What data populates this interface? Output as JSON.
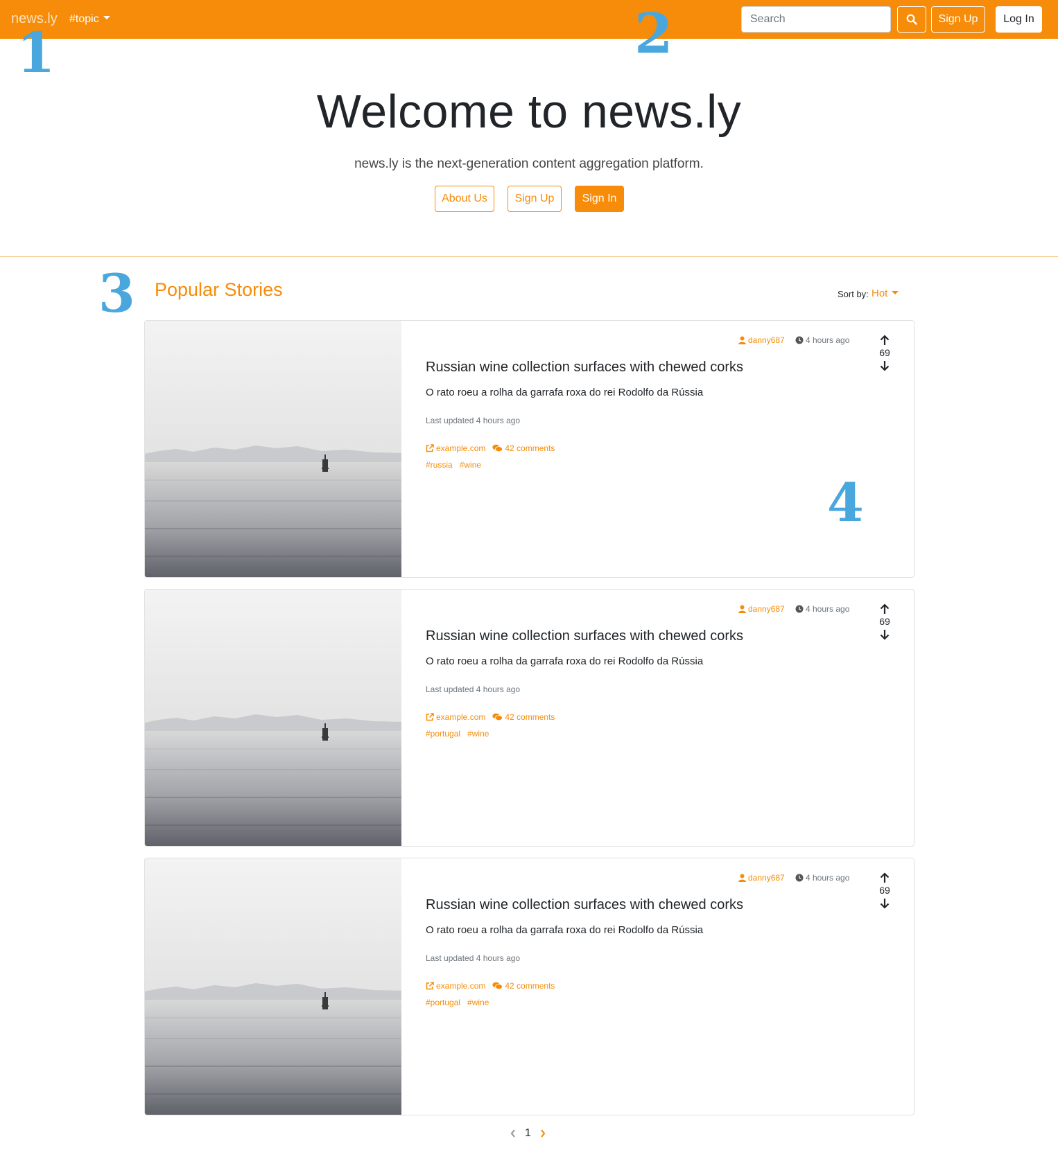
{
  "navbar": {
    "brand": "news.ly",
    "topic_dropdown": "#topic",
    "search_placeholder": "Search",
    "signup_label": "Sign Up",
    "login_label": "Log In",
    "accent_color": "#f68c09"
  },
  "annotations": [
    "1",
    "2",
    "3",
    "4"
  ],
  "hero": {
    "title": "Welcome to news.ly",
    "lead": "news.ly is the next-generation content aggregation platform.",
    "about_label": "About Us",
    "signup_label": "Sign Up",
    "signin_label": "Sign In"
  },
  "section": {
    "title": "Popular Stories",
    "sort_label": "Sort by:",
    "sort_value": "Hot"
  },
  "stories": [
    {
      "author": "danny687",
      "time": "4 hours ago",
      "votes": "69",
      "title": "Russian wine collection surfaces with chewed corks",
      "description": "O rato roeu a rolha da garrafa roxa do rei Rodolfo da Rússia",
      "updated": "Last updated 4 hours ago",
      "source": "example.com",
      "comments": "42 comments",
      "tags": [
        "#russia",
        "#wine"
      ]
    },
    {
      "author": "danny687",
      "time": "4 hours ago",
      "votes": "69",
      "title": "Russian wine collection surfaces with chewed corks",
      "description": "O rato roeu a rolha da garrafa roxa do rei Rodolfo da Rússia",
      "updated": "Last updated 4 hours ago",
      "source": "example.com",
      "comments": "42 comments",
      "tags": [
        "#portugal",
        "#wine"
      ]
    },
    {
      "author": "danny687",
      "time": "4 hours ago",
      "votes": "69",
      "title": "Russian wine collection surfaces with chewed corks",
      "description": "O rato roeu a rolha da garrafa roxa do rei Rodolfo da Rússia",
      "updated": "Last updated 4 hours ago",
      "source": "example.com",
      "comments": "42 comments",
      "tags": [
        "#portugal",
        "#wine"
      ]
    }
  ],
  "pagination": {
    "current_page": "1"
  },
  "icons": {
    "search": "search-icon",
    "user": "user-icon",
    "clock": "clock-icon",
    "upvote": "arrow-up-icon",
    "downvote": "arrow-down-icon",
    "external_link": "external-link-icon",
    "comments": "comments-icon",
    "prev": "chevron-left-icon",
    "next": "chevron-right-icon"
  }
}
